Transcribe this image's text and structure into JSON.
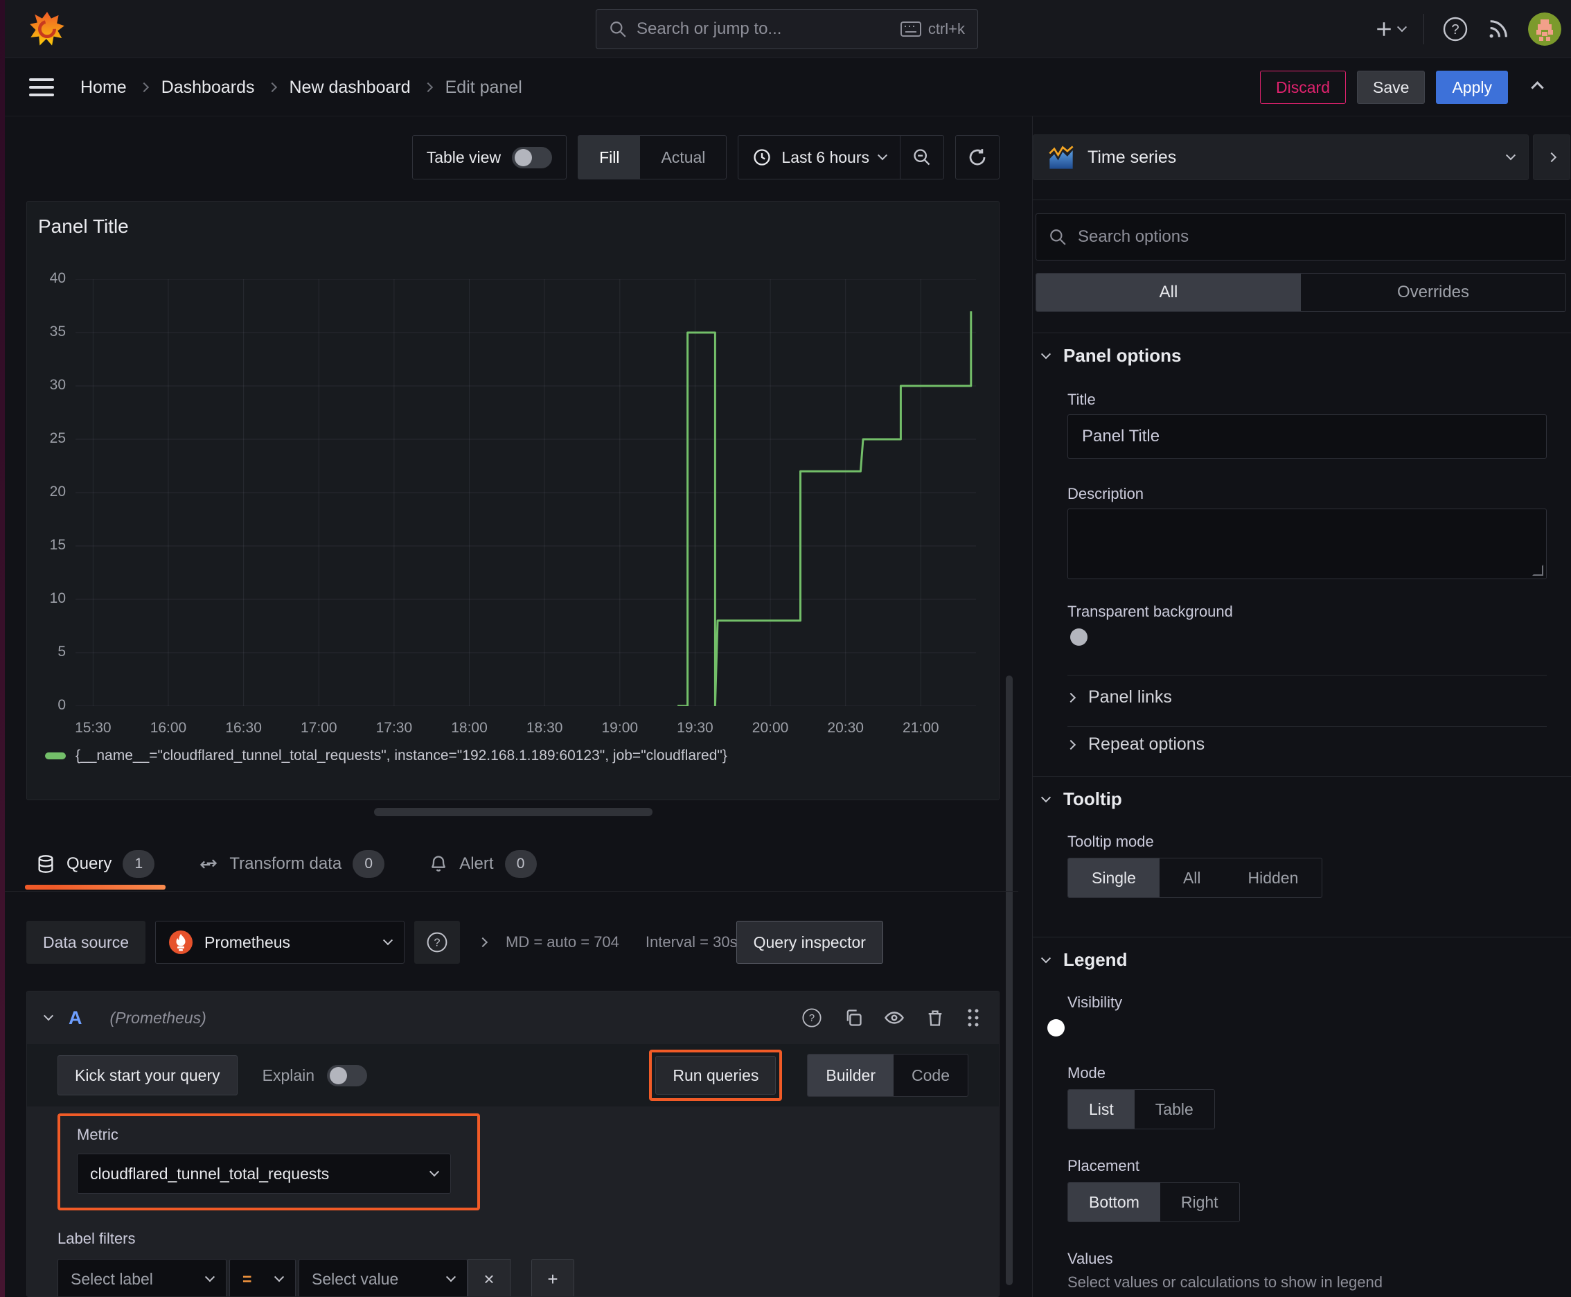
{
  "topbar": {
    "search_placeholder": "Search or jump to...",
    "search_shortcut": "ctrl+k"
  },
  "breadcrumb": {
    "items": [
      "Home",
      "Dashboards",
      "New dashboard",
      "Edit panel"
    ]
  },
  "actions": {
    "discard": "Discard",
    "save": "Save",
    "apply": "Apply"
  },
  "toolbar": {
    "table_view": "Table view",
    "fill": "Fill",
    "actual": "Actual",
    "time_range": "Last 6 hours"
  },
  "panel": {
    "title": "Panel Title",
    "legend_series": "{__name__=\"cloudflared_tunnel_total_requests\", instance=\"192.168.1.189:60123\", job=\"cloudflared\"}"
  },
  "chart_data": {
    "type": "line",
    "title": "Panel Title",
    "x_ticks": [
      "15:30",
      "16:00",
      "16:30",
      "17:00",
      "17:30",
      "18:00",
      "18:30",
      "19:00",
      "19:30",
      "20:00",
      "20:30",
      "21:00"
    ],
    "y_ticks": [
      0,
      5,
      10,
      15,
      20,
      25,
      30,
      35,
      40
    ],
    "ylim": [
      0,
      40
    ],
    "x_range": [
      "15:23",
      "21:22"
    ],
    "grid": true,
    "legend_position": "bottom",
    "series": [
      {
        "name": "{__name__=\"cloudflared_tunnel_total_requests\", instance=\"192.168.1.189:60123\", job=\"cloudflared\"}",
        "color": "#73bf69",
        "points": [
          [
            "19:23",
            0
          ],
          [
            "19:27",
            0
          ],
          [
            "19:27",
            35
          ],
          [
            "19:38",
            35
          ],
          [
            "19:38",
            0
          ],
          [
            "19:39",
            8
          ],
          [
            "20:12",
            8
          ],
          [
            "20:12",
            22
          ],
          [
            "20:36",
            22
          ],
          [
            "20:37",
            25
          ],
          [
            "20:52",
            25
          ],
          [
            "20:52",
            30
          ],
          [
            "21:20",
            30
          ],
          [
            "21:20",
            37
          ]
        ]
      }
    ]
  },
  "tabs": {
    "query": "Query",
    "query_count": "1",
    "transform": "Transform data",
    "transform_count": "0",
    "alert": "Alert",
    "alert_count": "0"
  },
  "query": {
    "datasource_label": "Data source",
    "datasource": "Prometheus",
    "stats_md": "MD = auto = 704",
    "stats_interval": "Interval = 30s",
    "inspector": "Query inspector",
    "ref_id": "A",
    "ref_ds": "(Prometheus)",
    "kickstart": "Kick start your query",
    "explain": "Explain",
    "run": "Run queries",
    "builder": "Builder",
    "code": "Code",
    "metric_label": "Metric",
    "metric_value": "cloudflared_tunnel_total_requests",
    "label_filters": "Label filters",
    "select_label": "Select label",
    "operator": "=",
    "select_value": "Select value",
    "remove": "×",
    "add": "+"
  },
  "sidebar": {
    "viz_type": "Time series",
    "search_placeholder": "Search options",
    "tab_all": "All",
    "tab_overrides": "Overrides",
    "panel_options": {
      "title": "Panel options",
      "title_label": "Title",
      "title_value": "Panel Title",
      "description_label": "Description",
      "transparent_label": "Transparent background"
    },
    "panel_links": "Panel links",
    "repeat_options": "Repeat options",
    "tooltip": {
      "title": "Tooltip",
      "mode_label": "Tooltip mode",
      "modes": [
        "Single",
        "All",
        "Hidden"
      ]
    },
    "legend": {
      "title": "Legend",
      "visibility_label": "Visibility",
      "mode_label": "Mode",
      "modes": [
        "List",
        "Table"
      ],
      "placement_label": "Placement",
      "placements": [
        "Bottom",
        "Right"
      ],
      "values_label": "Values",
      "values_help": "Select values or calculations to show in legend"
    }
  },
  "icons": {
    "grafana-logo": "orange-flame-swirl",
    "search": "magnifier",
    "keyboard": "keyboard",
    "plus": "+",
    "help": "?",
    "rss": "rss-waves",
    "avatar": "pixel-avatar",
    "clock": "clock-face",
    "zoom-out": "magnifier-minus",
    "refresh": "circular-arrow",
    "database": "db-cylinder",
    "transform": "cycle-arrows",
    "bell": "bell",
    "copy": "two-pages",
    "eye": "eye",
    "trash": "trash-can",
    "grip": "six-dots",
    "timeseries-viz": "blue-area-orange-line"
  },
  "colors": {
    "accent_orange": "#f15b27",
    "accent_blue": "#3d71d9",
    "series_green": "#73bf69",
    "discard_pink": "#e0226e"
  }
}
